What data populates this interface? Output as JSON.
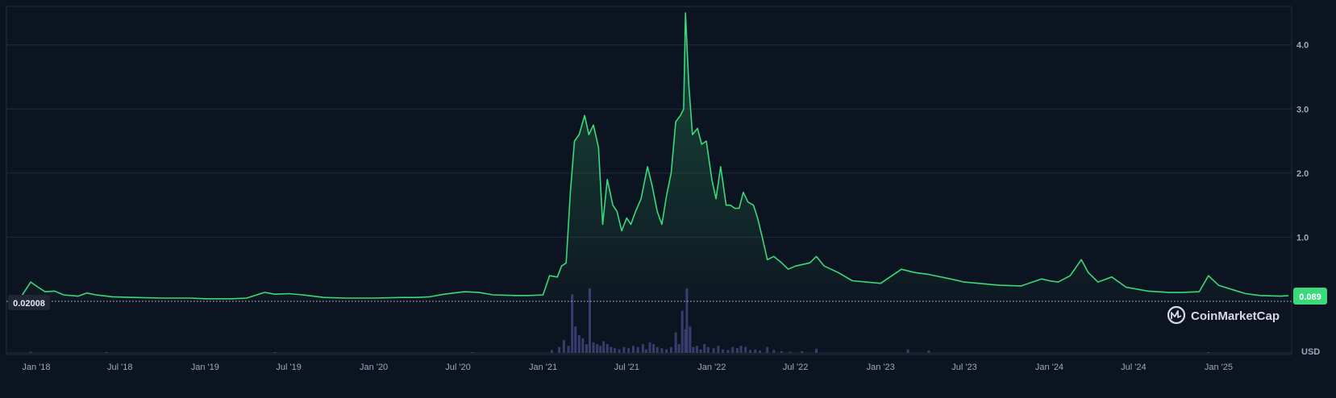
{
  "chart_data": {
    "type": "area",
    "y_ticks": [
      1.0,
      2.0,
      3.0,
      4.0
    ],
    "ylim": [
      0,
      4.6
    ],
    "x_tick_labels": [
      "Jan '18",
      "Jul '18",
      "Jan '19",
      "Jul '19",
      "Jan '20",
      "Jul '20",
      "Jan '21",
      "Jul '21",
      "Jan '22",
      "Jul '22",
      "Jan '23",
      "Jul '23",
      "Jan '24",
      "Jul '24",
      "Jan '25"
    ],
    "x_range": [
      "2017-11-01",
      "2025-06-01"
    ],
    "reference_label": "0.02008",
    "current_value_label": "0.089",
    "currency_label": "USD",
    "watermark": "CoinMarketCap",
    "line_color": "#3ad97a",
    "price_points": [
      [
        "2017-11-01",
        0.02
      ],
      [
        "2017-12-01",
        0.09
      ],
      [
        "2017-12-20",
        0.3
      ],
      [
        "2018-01-05",
        0.22
      ],
      [
        "2018-01-20",
        0.15
      ],
      [
        "2018-02-10",
        0.16
      ],
      [
        "2018-03-01",
        0.1
      ],
      [
        "2018-04-01",
        0.08
      ],
      [
        "2018-04-20",
        0.13
      ],
      [
        "2018-05-10",
        0.1
      ],
      [
        "2018-06-15",
        0.07
      ],
      [
        "2018-08-01",
        0.06
      ],
      [
        "2018-10-01",
        0.05
      ],
      [
        "2018-12-01",
        0.05
      ],
      [
        "2019-01-01",
        0.04
      ],
      [
        "2019-03-01",
        0.04
      ],
      [
        "2019-04-01",
        0.05
      ],
      [
        "2019-05-10",
        0.14
      ],
      [
        "2019-06-01",
        0.11
      ],
      [
        "2019-07-01",
        0.12
      ],
      [
        "2019-08-01",
        0.1
      ],
      [
        "2019-09-15",
        0.06
      ],
      [
        "2019-11-01",
        0.05
      ],
      [
        "2020-01-01",
        0.05
      ],
      [
        "2020-03-01",
        0.06
      ],
      [
        "2020-04-01",
        0.06
      ],
      [
        "2020-05-01",
        0.07
      ],
      [
        "2020-06-01",
        0.11
      ],
      [
        "2020-07-15",
        0.15
      ],
      [
        "2020-08-15",
        0.14
      ],
      [
        "2020-09-15",
        0.1
      ],
      [
        "2020-11-01",
        0.09
      ],
      [
        "2020-12-01",
        0.09
      ],
      [
        "2021-01-01",
        0.1
      ],
      [
        "2021-01-15",
        0.4
      ],
      [
        "2021-02-01",
        0.38
      ],
      [
        "2021-02-10",
        0.55
      ],
      [
        "2021-02-20",
        0.6
      ],
      [
        "2021-03-01",
        1.7
      ],
      [
        "2021-03-10",
        2.5
      ],
      [
        "2021-03-20",
        2.6
      ],
      [
        "2021-04-01",
        2.9
      ],
      [
        "2021-04-10",
        2.6
      ],
      [
        "2021-04-20",
        2.75
      ],
      [
        "2021-05-01",
        2.4
      ],
      [
        "2021-05-10",
        1.2
      ],
      [
        "2021-05-20",
        1.9
      ],
      [
        "2021-06-01",
        1.5
      ],
      [
        "2021-06-10",
        1.4
      ],
      [
        "2021-06-20",
        1.1
      ],
      [
        "2021-07-01",
        1.3
      ],
      [
        "2021-07-10",
        1.2
      ],
      [
        "2021-07-20",
        1.4
      ],
      [
        "2021-08-01",
        1.6
      ],
      [
        "2021-08-15",
        2.1
      ],
      [
        "2021-08-25",
        1.8
      ],
      [
        "2021-09-05",
        1.4
      ],
      [
        "2021-09-15",
        1.2
      ],
      [
        "2021-09-25",
        1.65
      ],
      [
        "2021-10-05",
        2.0
      ],
      [
        "2021-10-15",
        2.8
      ],
      [
        "2021-10-25",
        2.9
      ],
      [
        "2021-11-01",
        3.0
      ],
      [
        "2021-11-05",
        4.5
      ],
      [
        "2021-11-12",
        3.4
      ],
      [
        "2021-11-20",
        2.6
      ],
      [
        "2021-12-01",
        2.7
      ],
      [
        "2021-12-10",
        2.45
      ],
      [
        "2021-12-20",
        2.5
      ],
      [
        "2022-01-01",
        1.9
      ],
      [
        "2022-01-10",
        1.6
      ],
      [
        "2022-01-20",
        2.1
      ],
      [
        "2022-02-01",
        1.5
      ],
      [
        "2022-02-10",
        1.5
      ],
      [
        "2022-02-20",
        1.45
      ],
      [
        "2022-03-01",
        1.45
      ],
      [
        "2022-03-10",
        1.7
      ],
      [
        "2022-03-20",
        1.55
      ],
      [
        "2022-04-01",
        1.5
      ],
      [
        "2022-04-10",
        1.3
      ],
      [
        "2022-04-20",
        1.0
      ],
      [
        "2022-05-01",
        0.65
      ],
      [
        "2022-05-15",
        0.7
      ],
      [
        "2022-06-01",
        0.6
      ],
      [
        "2022-06-15",
        0.5
      ],
      [
        "2022-07-01",
        0.55
      ],
      [
        "2022-08-01",
        0.6
      ],
      [
        "2022-08-15",
        0.7
      ],
      [
        "2022-09-01",
        0.55
      ],
      [
        "2022-10-01",
        0.45
      ],
      [
        "2022-11-01",
        0.32
      ],
      [
        "2022-12-01",
        0.3
      ],
      [
        "2023-01-01",
        0.28
      ],
      [
        "2023-02-15",
        0.5
      ],
      [
        "2023-03-15",
        0.45
      ],
      [
        "2023-04-15",
        0.42
      ],
      [
        "2023-06-01",
        0.35
      ],
      [
        "2023-07-01",
        0.3
      ],
      [
        "2023-08-01",
        0.28
      ],
      [
        "2023-09-15",
        0.25
      ],
      [
        "2023-11-01",
        0.24
      ],
      [
        "2023-12-15",
        0.35
      ],
      [
        "2024-01-01",
        0.32
      ],
      [
        "2024-01-20",
        0.3
      ],
      [
        "2024-02-15",
        0.4
      ],
      [
        "2024-03-10",
        0.65
      ],
      [
        "2024-03-25",
        0.45
      ],
      [
        "2024-04-15",
        0.3
      ],
      [
        "2024-05-15",
        0.38
      ],
      [
        "2024-06-15",
        0.22
      ],
      [
        "2024-08-01",
        0.16
      ],
      [
        "2024-09-15",
        0.14
      ],
      [
        "2024-10-15",
        0.14
      ],
      [
        "2024-11-20",
        0.15
      ],
      [
        "2024-12-10",
        0.4
      ],
      [
        "2025-01-01",
        0.25
      ],
      [
        "2025-02-01",
        0.18
      ],
      [
        "2025-03-01",
        0.12
      ],
      [
        "2025-04-01",
        0.09
      ],
      [
        "2025-05-15",
        0.08
      ],
      [
        "2025-06-01",
        0.089
      ]
    ],
    "volume_bars": [
      [
        "2017-12-20",
        0.02
      ],
      [
        "2018-06-01",
        0.01
      ],
      [
        "2019-06-01",
        0.01
      ],
      [
        "2020-08-01",
        0.01
      ],
      [
        "2021-01-20",
        0.05
      ],
      [
        "2021-02-05",
        0.1
      ],
      [
        "2021-02-15",
        0.22
      ],
      [
        "2021-02-25",
        0.12
      ],
      [
        "2021-03-05",
        1.0
      ],
      [
        "2021-03-12",
        0.45
      ],
      [
        "2021-03-20",
        0.3
      ],
      [
        "2021-03-28",
        0.25
      ],
      [
        "2021-04-05",
        0.15
      ],
      [
        "2021-04-12",
        1.1
      ],
      [
        "2021-04-20",
        0.18
      ],
      [
        "2021-04-28",
        0.15
      ],
      [
        "2021-05-05",
        0.12
      ],
      [
        "2021-05-12",
        0.2
      ],
      [
        "2021-05-20",
        0.15
      ],
      [
        "2021-05-28",
        0.1
      ],
      [
        "2021-06-05",
        0.08
      ],
      [
        "2021-06-15",
        0.06
      ],
      [
        "2021-06-25",
        0.1
      ],
      [
        "2021-07-05",
        0.08
      ],
      [
        "2021-07-15",
        0.12
      ],
      [
        "2021-07-25",
        0.1
      ],
      [
        "2021-08-05",
        0.15
      ],
      [
        "2021-08-12",
        0.06
      ],
      [
        "2021-08-20",
        0.18
      ],
      [
        "2021-08-28",
        0.15
      ],
      [
        "2021-09-05",
        0.1
      ],
      [
        "2021-09-15",
        0.08
      ],
      [
        "2021-09-25",
        0.06
      ],
      [
        "2021-10-05",
        0.1
      ],
      [
        "2021-10-15",
        0.35
      ],
      [
        "2021-10-22",
        0.15
      ],
      [
        "2021-10-29",
        0.72
      ],
      [
        "2021-11-05",
        0.4
      ],
      [
        "2021-11-08",
        1.1
      ],
      [
        "2021-11-15",
        0.45
      ],
      [
        "2021-11-22",
        0.1
      ],
      [
        "2021-11-30",
        0.12
      ],
      [
        "2021-12-08",
        0.06
      ],
      [
        "2021-12-16",
        0.15
      ],
      [
        "2021-12-24",
        0.1
      ],
      [
        "2022-01-05",
        0.08
      ],
      [
        "2022-01-15",
        0.12
      ],
      [
        "2022-01-25",
        0.06
      ],
      [
        "2022-02-05",
        0.05
      ],
      [
        "2022-02-15",
        0.1
      ],
      [
        "2022-02-25",
        0.08
      ],
      [
        "2022-03-05",
        0.12
      ],
      [
        "2022-03-15",
        0.1
      ],
      [
        "2022-03-25",
        0.05
      ],
      [
        "2022-04-05",
        0.06
      ],
      [
        "2022-04-15",
        0.04
      ],
      [
        "2022-05-01",
        0.1
      ],
      [
        "2022-05-15",
        0.05
      ],
      [
        "2022-06-01",
        0.03
      ],
      [
        "2022-06-20",
        0.02
      ],
      [
        "2022-07-15",
        0.03
      ],
      [
        "2022-08-15",
        0.07
      ],
      [
        "2023-03-01",
        0.06
      ],
      [
        "2023-04-15",
        0.04
      ],
      [
        "2024-12-10",
        0.01
      ]
    ]
  }
}
